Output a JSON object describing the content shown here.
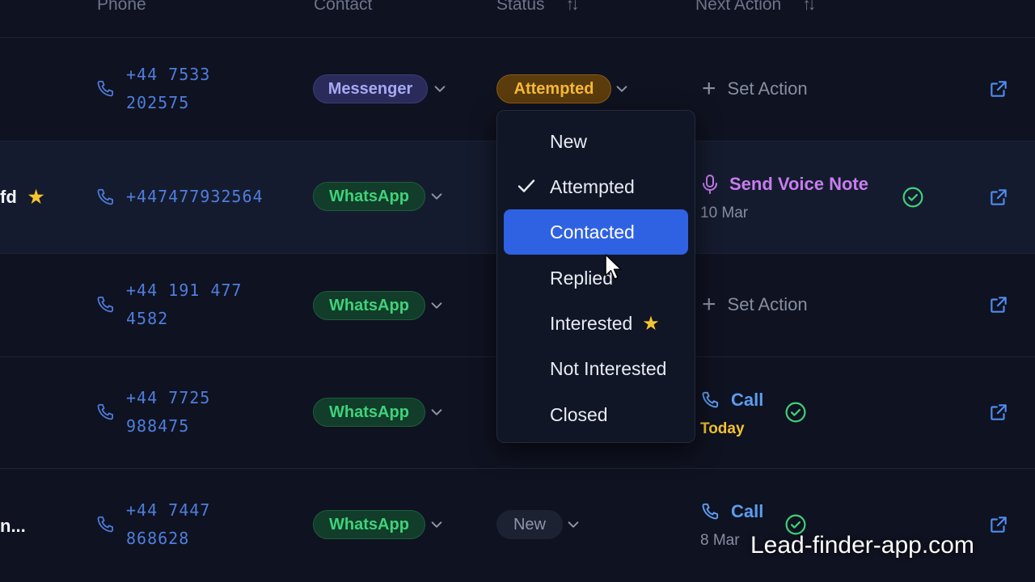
{
  "header": {
    "phone": "Phone",
    "contact": "Contact",
    "status": "Status",
    "next_action": "Next Action",
    "sort_icon": "↑↓"
  },
  "rows": [
    {
      "name": "",
      "phone_line1": "+44 7533",
      "phone_line2": "202575",
      "contact": "Messenger",
      "status": "Attempted",
      "action_label": "Set Action"
    },
    {
      "name": "fd",
      "starred": true,
      "phone_line1": "+447477932564",
      "contact": "WhatsApp",
      "action_label": "Send Voice Note",
      "action_icon": "microphone-icon",
      "action_date": "10 Mar",
      "action_color": "#c77dee"
    },
    {
      "name": "",
      "phone_line1": "+44 191 477",
      "phone_line2": "4582",
      "contact": "WhatsApp",
      "action_label": "Set Action"
    },
    {
      "name": "",
      "phone_line1": "+44 7725",
      "phone_line2": "988475",
      "contact": "WhatsApp",
      "action_label": "Call",
      "action_icon": "phone-icon",
      "action_date": "Today",
      "action_color": "#5b9cf0",
      "date_color": "#f4c430"
    },
    {
      "name": "n...",
      "phone_line1": "+44 7447",
      "phone_line2": "868628",
      "contact": "WhatsApp",
      "status": "New",
      "action_label": "Call",
      "action_icon": "phone-icon",
      "action_date": "8 Mar",
      "action_color": "#5b9cf0"
    }
  ],
  "status_dropdown": {
    "options": [
      "New",
      "Attempted",
      "Contacted",
      "Replied",
      "Interested",
      "Not Interested",
      "Closed"
    ],
    "checked": "Attempted",
    "hovered": "Contacted",
    "starred_option": "Interested"
  },
  "colors": {
    "background": "#0f1220",
    "accent": "#2f62e3",
    "whatsapp": "#3fd27a",
    "messenger": "#a7a9f4",
    "attempted": "#f7b839",
    "phone_text": "#4e7ede"
  },
  "watermark": "Lead-finder-app.com"
}
